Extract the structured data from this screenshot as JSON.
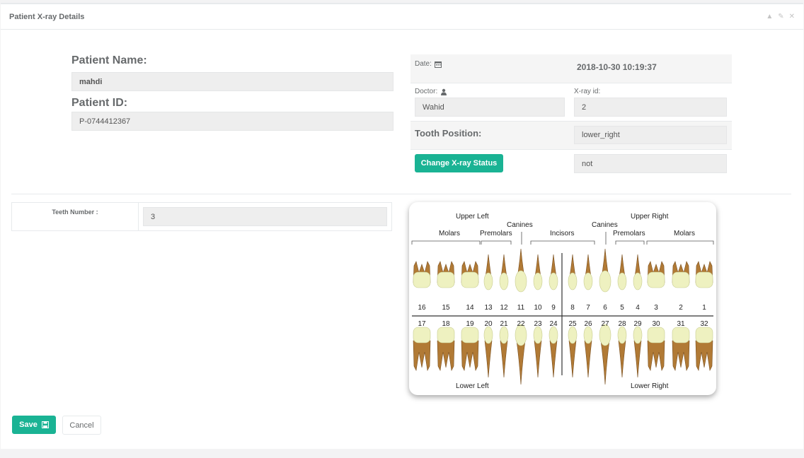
{
  "panel": {
    "title": "Patient X-ray Details",
    "tools": [
      "▲",
      "✎",
      "✕"
    ]
  },
  "patient": {
    "name_label": "Patient Name:",
    "name_value": "mahdi",
    "id_label": "Patient ID:",
    "id_value": "P-0744412367"
  },
  "xray": {
    "date_label": "Date:",
    "date_value": "2018-10-30 10:19:37",
    "doctor_label": "Doctor:",
    "doctor_value": "Wahid",
    "xray_id_label": "X-ray id:",
    "xray_id_value": "2",
    "tooth_position_label": "Tooth Position:",
    "tooth_position_value": "lower_right",
    "status_button": "Change X-ray Status",
    "status_value": "not"
  },
  "teeth": {
    "label": "Teeth Number :",
    "value": "3"
  },
  "chart": {
    "upper_left": "Upper Left",
    "upper_right": "Upper Right",
    "lower_left": "Lower Left",
    "lower_right": "Lower Right",
    "molars": "Molars",
    "premolars": "Premolars",
    "canines": "Canines",
    "incisors": "Incisors",
    "upper_numbers": [
      "16",
      "15",
      "14",
      "13",
      "12",
      "11",
      "10",
      "9",
      "8",
      "7",
      "6",
      "5",
      "4",
      "3",
      "2",
      "1"
    ],
    "lower_numbers": [
      "17",
      "18",
      "19",
      "20",
      "21",
      "22",
      "23",
      "24",
      "25",
      "26",
      "27",
      "28",
      "29",
      "30",
      "31",
      "32"
    ],
    "crown_color": "#eef1c0",
    "root_color": "#b17a35"
  },
  "actions": {
    "save": "Save",
    "cancel": "Cancel"
  },
  "colors": {
    "primary": "#1ab394"
  }
}
